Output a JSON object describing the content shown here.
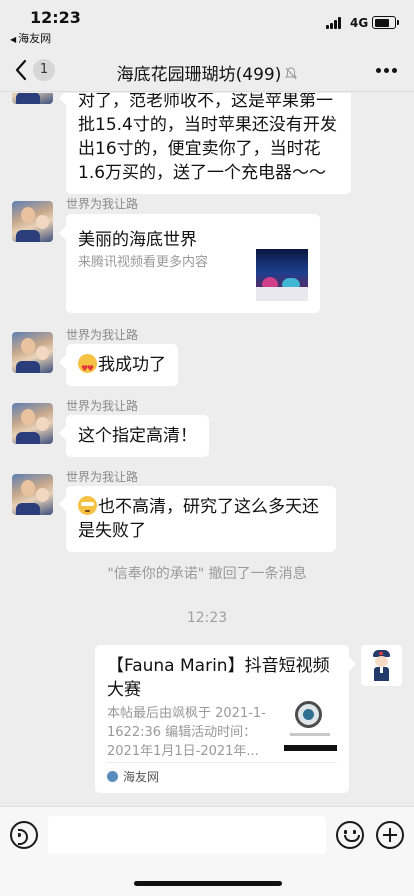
{
  "status_bar": {
    "time": "12:23",
    "back_app": "海友网",
    "network": "4G",
    "battery_level": 0.8
  },
  "nav": {
    "unread_count": "1",
    "title": "海底花园珊瑚坊(499)",
    "mute_icon": "mute-bell-icon",
    "more_icon": "more-dots-icon"
  },
  "messages": {
    "m1": {
      "text": "对了，范老师收不，这是苹果第一批15.4寸的，当时苹果还没有开发出16寸的，便宜卖你了，当时花1.6万买的，送了一个充电器～～"
    },
    "m2": {
      "sender": "世界为我让路",
      "title": "美丽的海底世界",
      "subtitle": "来腾讯视频看更多内容"
    },
    "m3": {
      "sender": "世界为我让路",
      "text": "我成功了",
      "emoji": "heart-eyes-emoji"
    },
    "m4": {
      "sender": "世界为我让路",
      "text": "这个指定高清！"
    },
    "m5": {
      "sender": "世界为我让路",
      "text": "也不高清，研究了这么多天还是失败了",
      "emoji": "flushed-emoji"
    }
  },
  "recall_notice": "\"信奉你的承诺\" 撤回了一条消息",
  "timestamp": "12:23",
  "link_card": {
    "title": "【Fauna Marin】抖音短视频大赛",
    "description": "本帖最后由飒枫于 2021-1-1622:36 编辑活动时间：2021年1月1日-2021年...",
    "source": "海友网"
  },
  "input": {
    "placeholder": "",
    "voice_icon": "voice-icon",
    "emoji_icon": "emoji-icon",
    "plus_icon": "plus-icon"
  }
}
